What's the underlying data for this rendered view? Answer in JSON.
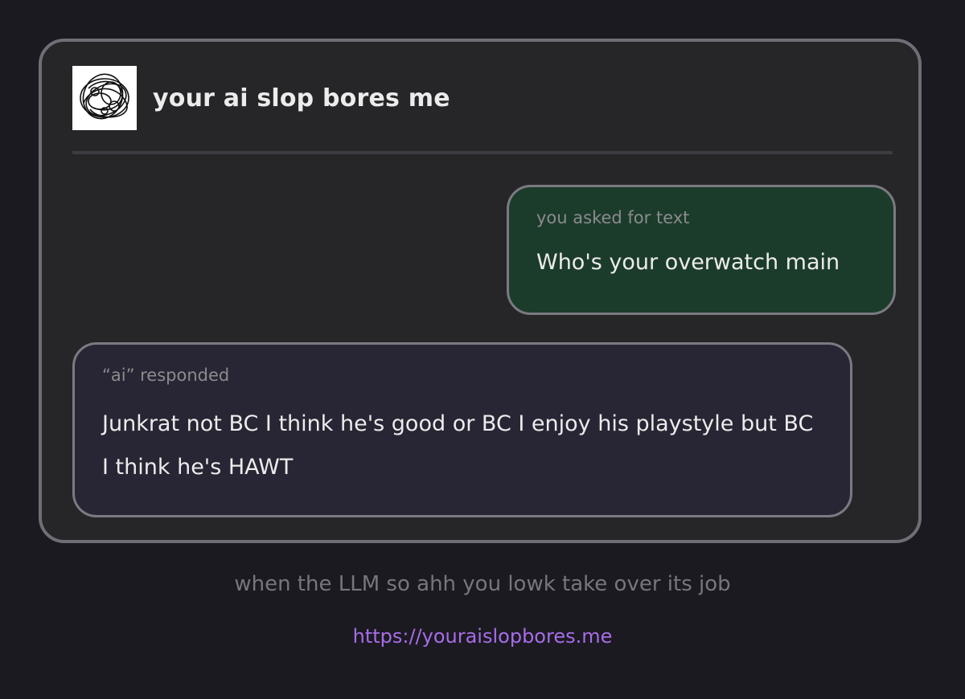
{
  "card": {
    "title": "your ai slop bores me",
    "avatar_icon": "scribble-logo-icon"
  },
  "user_message": {
    "caption": "you asked for text",
    "text": "Who's your overwatch main"
  },
  "ai_message": {
    "caption": "“ai” responded",
    "text": "Junkrat not BC I think he's good or BC I enjoy his playstyle but BC I think he's HAWT"
  },
  "footer": {
    "caption": "when the LLM so ahh you lowk take over its job",
    "link": "https://youraislopbores.me"
  },
  "colors": {
    "background": "#1b1a20",
    "card": "#262628",
    "user_bubble": "#1c3c2b",
    "ai_bubble": "#282634",
    "link": "#a66de8"
  }
}
